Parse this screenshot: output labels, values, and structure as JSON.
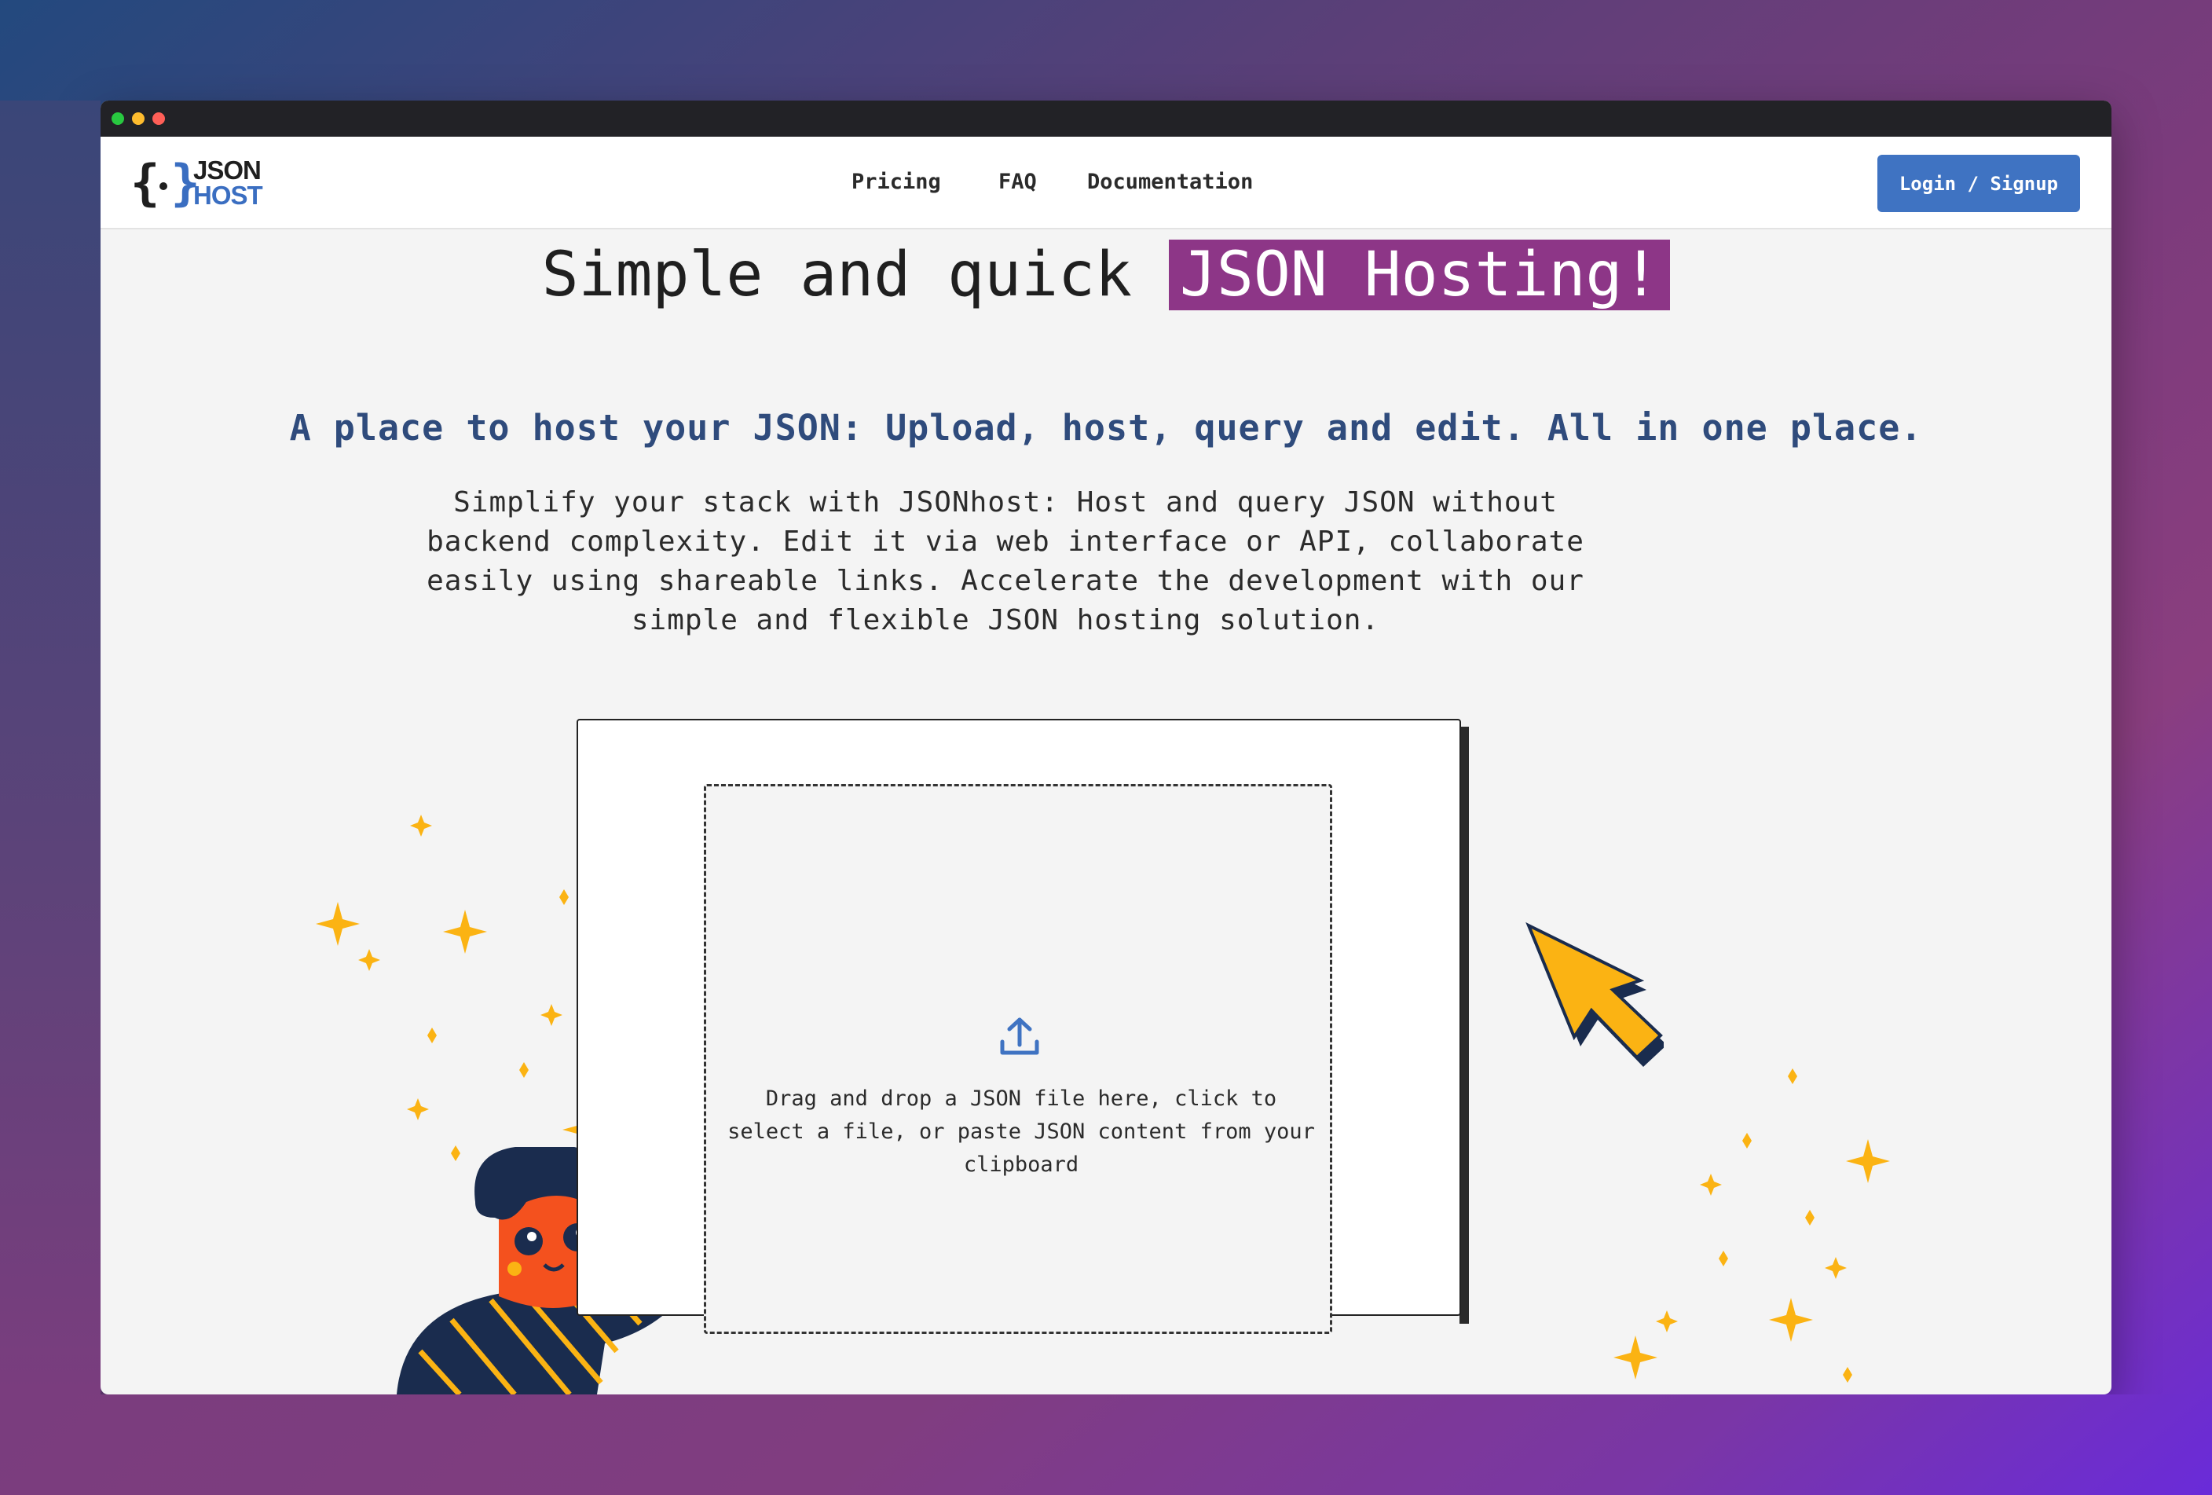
{
  "window": {
    "traffic_lights": [
      "green",
      "yellow",
      "red"
    ]
  },
  "logo": {
    "word1": "JSON",
    "word2": "HOST",
    "icon": "curly-braces-icon"
  },
  "nav": {
    "items": [
      {
        "label": "Pricing"
      },
      {
        "label": "FAQ"
      },
      {
        "label": "Documentation"
      }
    ],
    "login_label": "Login / Signup"
  },
  "hero": {
    "title_plain": "Simple and quick ",
    "title_highlight": "JSON Hosting!",
    "subtitle": "A place to host your JSON: Upload, host, query and edit. All in one place.",
    "description": "Simplify your stack with JSONhost: Host and query JSON without backend complexity. Edit it via web interface or API, collaborate easily using shareable links. Accelerate the development with our simple and flexible JSON hosting solution."
  },
  "upload": {
    "icon": "upload-icon",
    "text": "Drag and drop a JSON file here, click to select a file, or paste JSON content from your clipboard"
  },
  "colors": {
    "accent_blue": "#3f73c2",
    "highlight_purple": "#8d3687",
    "subtitle_blue": "#2f4b7c",
    "star_yellow": "#fbb313",
    "character_orange": "#f4511e"
  }
}
